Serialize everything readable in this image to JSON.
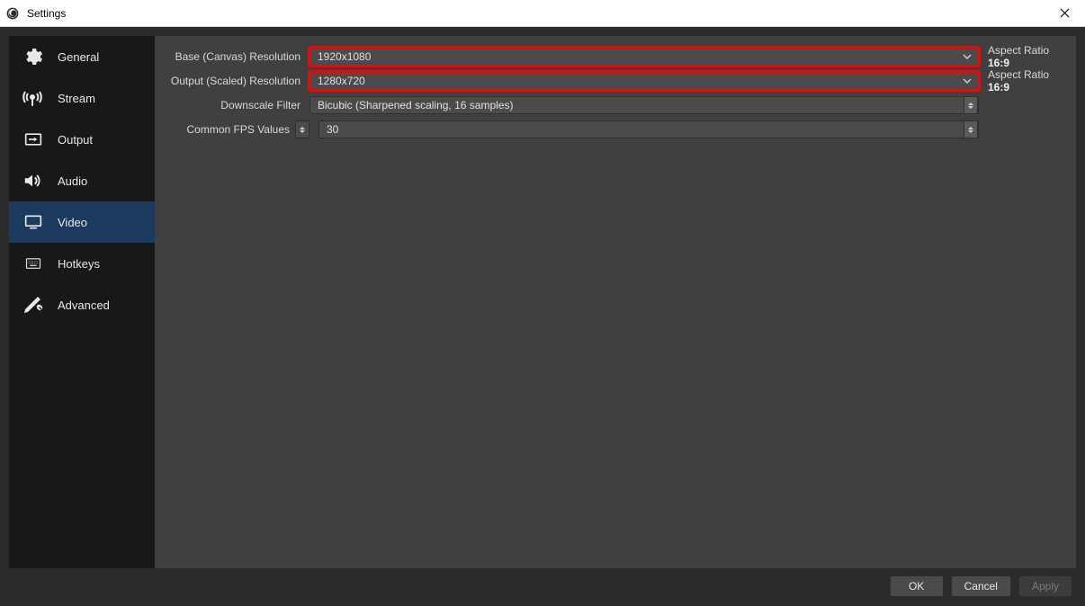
{
  "window": {
    "title": "Settings"
  },
  "sidebar": {
    "items": [
      {
        "label": "General"
      },
      {
        "label": "Stream"
      },
      {
        "label": "Output"
      },
      {
        "label": "Audio"
      },
      {
        "label": "Video"
      },
      {
        "label": "Hotkeys"
      },
      {
        "label": "Advanced"
      }
    ],
    "selected_index": 4
  },
  "video": {
    "base_resolution": {
      "label": "Base (Canvas) Resolution",
      "value": "1920x1080",
      "aspect_prefix": "Aspect Ratio ",
      "aspect_ratio": "16:9"
    },
    "output_resolution": {
      "label": "Output (Scaled) Resolution",
      "value": "1280x720",
      "aspect_prefix": "Aspect Ratio ",
      "aspect_ratio": "16:9"
    },
    "downscale_filter": {
      "label": "Downscale Filter",
      "value": "Bicubic (Sharpened scaling, 16 samples)"
    },
    "fps": {
      "label": "Common FPS Values",
      "value": "30"
    }
  },
  "buttons": {
    "ok": "OK",
    "cancel": "Cancel",
    "apply": "Apply"
  }
}
